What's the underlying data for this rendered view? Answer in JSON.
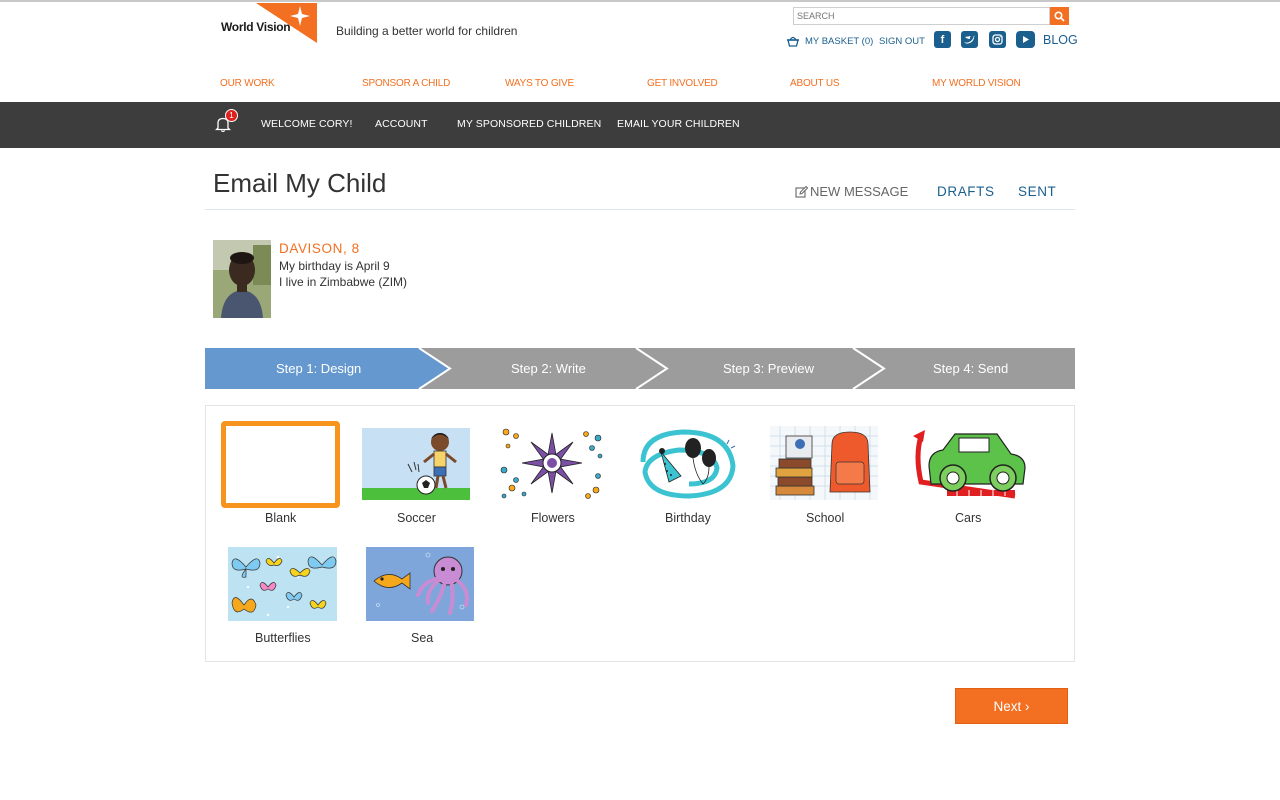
{
  "header": {
    "logo_text": "World Vision",
    "tagline": "Building a better world for children",
    "search_placeholder": "SEARCH",
    "basket": "MY BASKET (0)",
    "sign_out": "SIGN OUT",
    "blog": "BLOG",
    "social_icons": [
      "facebook-icon",
      "twitter-icon",
      "instagram-icon",
      "youtube-icon"
    ]
  },
  "main_nav": [
    "OUR WORK",
    "SPONSOR A CHILD",
    "WAYS TO GIVE",
    "GET INVOLVED",
    "ABOUT US",
    "MY WORLD VISION"
  ],
  "account_bar": {
    "notification_count": "1",
    "links": [
      "WELCOME CORY!",
      "ACCOUNT",
      "MY SPONSORED CHILDREN",
      "EMAIL YOUR CHILDREN"
    ]
  },
  "page": {
    "title": "Email My Child",
    "tabs": {
      "new_message": "NEW MESSAGE",
      "drafts": "DRAFTS",
      "sent": "SENT"
    }
  },
  "child": {
    "name": "DAVISON, 8",
    "birthday": "My birthday is April 9",
    "location": "I live in Zimbabwe (ZIM)"
  },
  "steps": [
    "Step 1: Design",
    "Step 2: Write",
    "Step 3: Preview",
    "Step 4: Send"
  ],
  "active_step": 1,
  "designs": [
    "Blank",
    "Soccer",
    "Flowers",
    "Birthday",
    "School",
    "Cars",
    "Butterflies",
    "Sea"
  ],
  "selected_design": "Blank",
  "next_button": "Next ›",
  "colors": {
    "brand_orange": "#f36f21",
    "link_blue": "#1a5f8e",
    "dark_bar": "#3d3d3d",
    "step_active": "#6598cf",
    "step_inactive": "#9c9c9c"
  }
}
